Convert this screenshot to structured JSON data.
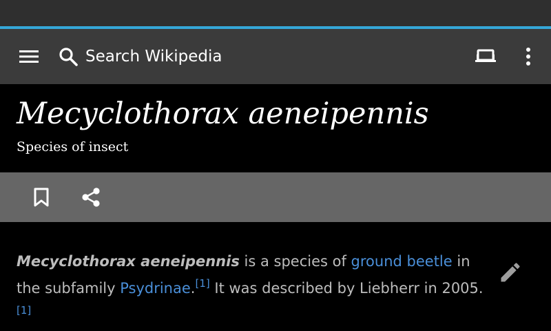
{
  "toolbar": {
    "menu_icon": "hamburger-menu-icon",
    "search_icon": "search-icon",
    "search_placeholder": "Search Wikipedia",
    "reading_list_icon": "reading-list-icon",
    "more_icon": "more-vertical-icon"
  },
  "article": {
    "title": "Mecyclothorax aeneipennis",
    "description": "Species of insect"
  },
  "actions": {
    "bookmark_icon": "bookmark-icon",
    "share_icon": "share-icon"
  },
  "content": {
    "lead_bold": "Mecyclothorax aeneipennis",
    "text1": " is a species of ",
    "link1": "ground beetle",
    "text2": " in the subfamily ",
    "link2": "Psydrinae",
    "text3": ".",
    "ref1": "[1]",
    "text4": " It was described by Liebherr in 2005.",
    "ref2": "[1]",
    "edit_icon": "edit-pencil-icon"
  },
  "colors": {
    "toolbar_bg": "#3b3b3b",
    "progress": "#35a7d8",
    "actionbar_bg": "#666666",
    "link": "#4a8fd9"
  }
}
